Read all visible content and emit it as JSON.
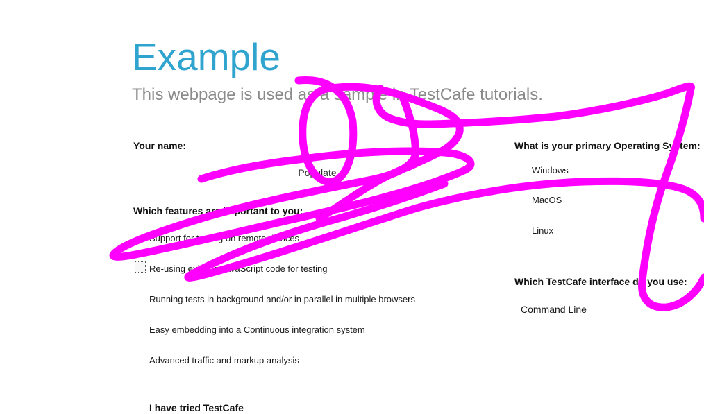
{
  "page": {
    "title": "Example",
    "subtitle": "This webpage is used as a sample in TestCafe tutorials."
  },
  "name_section": {
    "label": "Your name:",
    "input_value": "",
    "populate_label": "Populate"
  },
  "features": {
    "label": "Which features are important to you:",
    "items": [
      {
        "label": "Support for testing on remote devices",
        "checked": false,
        "focused": false
      },
      {
        "label": "Re-using existing JavaScript code for testing",
        "checked": false,
        "focused": true
      },
      {
        "label": "Running tests in background and/or in parallel in multiple browsers",
        "checked": false,
        "focused": false
      },
      {
        "label": "Easy embedding into a Continuous integration system",
        "checked": false,
        "focused": false
      },
      {
        "label": "Advanced traffic and markup analysis",
        "checked": false,
        "focused": false
      }
    ]
  },
  "tried": {
    "label": "I have tried TestCafe"
  },
  "os": {
    "label": "What is your primary Operating System:",
    "options": [
      "Windows",
      "MacOS",
      "Linux"
    ]
  },
  "interface": {
    "label": "Which TestCafe interface do you use:",
    "selected": "Command Line"
  },
  "overlay": {
    "stroke_color": "#ff00ff"
  }
}
